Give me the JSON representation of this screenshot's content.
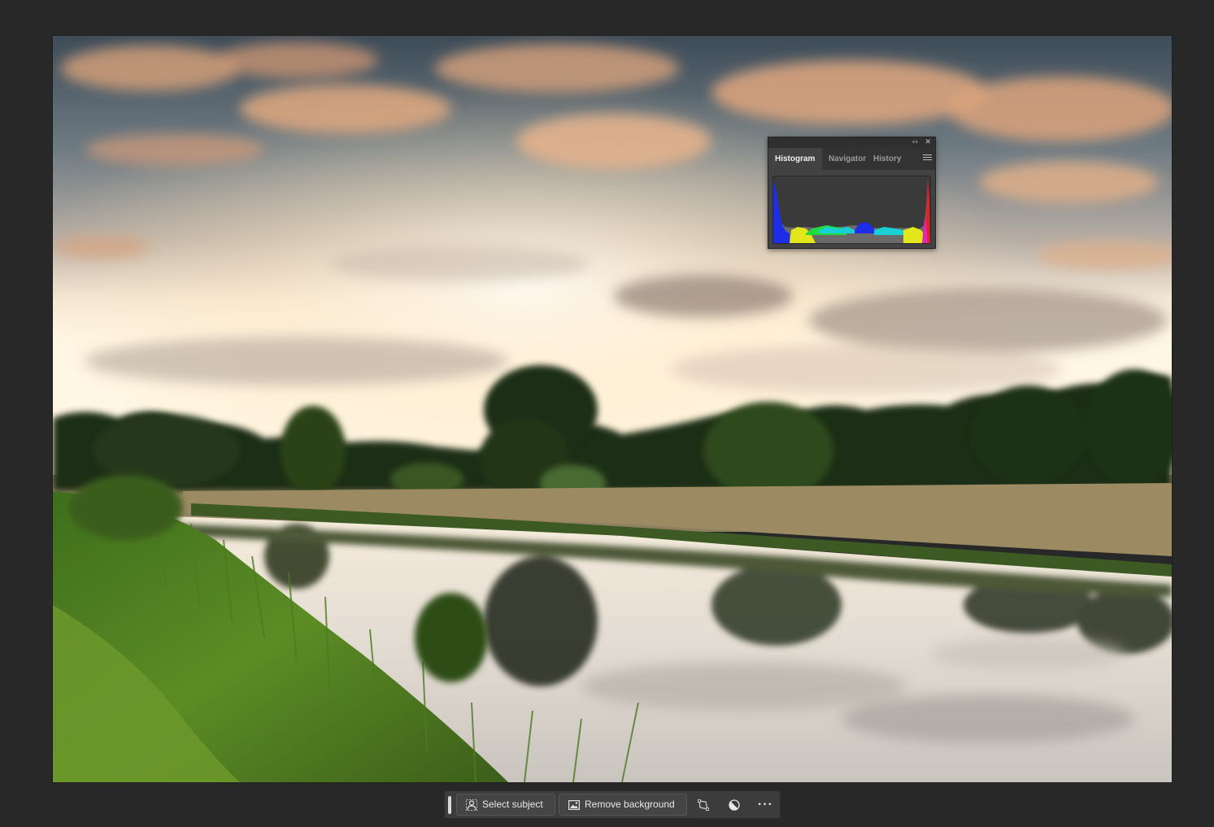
{
  "panel": {
    "collapse_glyph": "‹‹",
    "close_glyph": "✕",
    "tabs": [
      {
        "label": "Histogram",
        "active": true
      },
      {
        "label": "Navigator",
        "active": false
      },
      {
        "label": "History",
        "active": false
      }
    ],
    "menu_icon": "hamburger-menu-icon"
  },
  "taskbar": {
    "select_subject_label": "Select subject",
    "remove_background_label": "Remove background",
    "more_glyph": "•••",
    "icons": {
      "select_subject": "person-select-icon",
      "remove_background": "image-icon",
      "transform": "transform-warp-icon",
      "adjust": "adjustment-circle-icon",
      "more": "more-options-icon"
    }
  },
  "colors": {
    "workspace_bg": "#282828",
    "panel_bg": "#424242",
    "taskbar_bg": "#3c3c3c"
  }
}
